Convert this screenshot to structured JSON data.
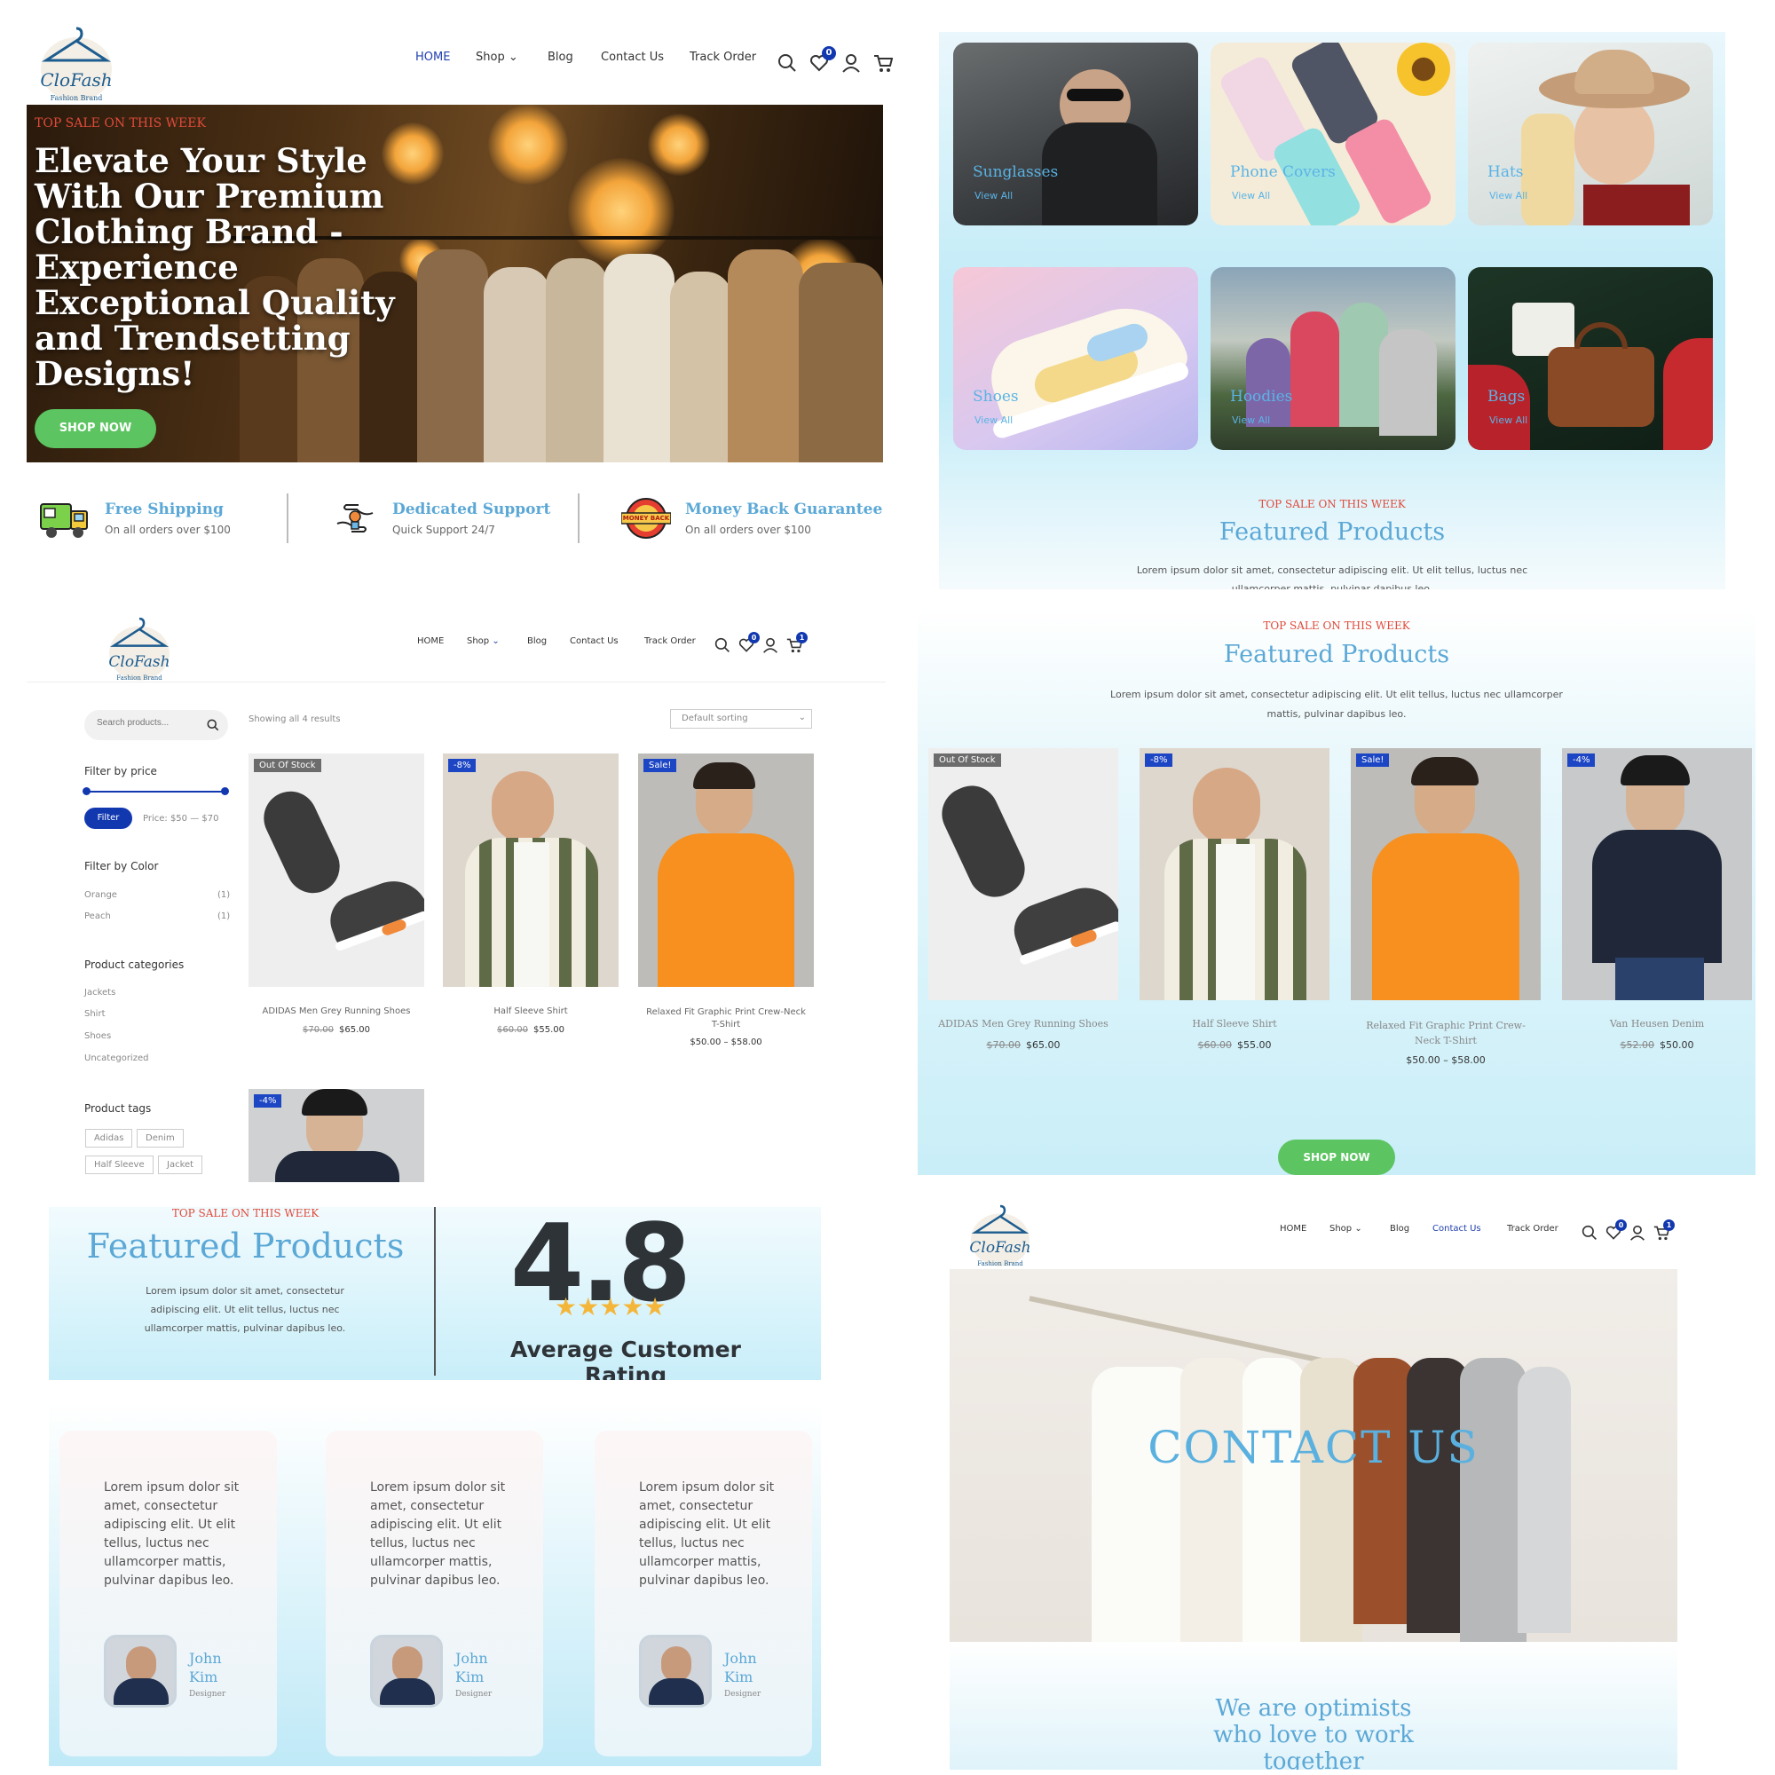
{
  "colors": {
    "accent_blue": "#5ba8d6",
    "nav_active": "#1f3fae",
    "sale_red": "#e04a3a",
    "button_green": "#5cc461",
    "badge_blue": "#1238b0",
    "panel_sky": "#bdeaf7"
  },
  "brand": {
    "logo_text": "CloFash",
    "logo_sub": "Fashion Brand"
  },
  "nav": {
    "home": "HOME",
    "shop": "Shop",
    "blog": "Blog",
    "contact": "Contact Us",
    "track": "Track Order",
    "wishlist_count": "0",
    "cart_count": "1"
  },
  "hero": {
    "eyebrow": "TOP SALE ON THIS WEEK",
    "title": "Elevate Your Style With Our Premium Clothing Brand - Experience Exceptional Quality and Trendsetting Designs!",
    "button": "SHOP NOW"
  },
  "features": [
    {
      "icon": "truck-icon",
      "title": "Free Shipping",
      "sub": "On all orders over $100"
    },
    {
      "icon": "support-icon",
      "title": "Dedicated Support",
      "sub": "Quick Support 24/7"
    },
    {
      "icon": "money-back-icon",
      "title": "Money Back Guarantee",
      "sub": "On all orders over $100",
      "badge_text": "MONEY BACK"
    }
  ],
  "categories": [
    {
      "name": "Sunglasses",
      "link": "View All"
    },
    {
      "name": "Phone Covers",
      "link": "View All"
    },
    {
      "name": "Hats",
      "link": "View All"
    },
    {
      "name": "Shoes",
      "link": "View All"
    },
    {
      "name": "Hoodies",
      "link": "View All"
    },
    {
      "name": "Bags",
      "link": "View All"
    }
  ],
  "featured": {
    "eyebrow": "TOP SALE ON THIS WEEK",
    "title": "Featured Products",
    "desc": "Lorem ipsum dolor sit amet, consectetur adipiscing elit. Ut elit tellus, luctus nec ullamcorper mattis, pulvinar dapibus leo."
  },
  "shop": {
    "search_placeholder": "Search products...",
    "result_count": "Showing all 4 results",
    "sorting": "Default sorting",
    "filter_price_heading": "Filter by price",
    "filter_button": "Filter",
    "price_range": "Price: $50 — $70",
    "filter_color_heading": "Filter by Color",
    "colors": [
      {
        "name": "Orange",
        "count": "(1)"
      },
      {
        "name": "Peach",
        "count": "(1)"
      }
    ],
    "categories_heading": "Product categories",
    "categories": [
      "Jackets",
      "Shirt",
      "Shoes",
      "Uncategorized"
    ],
    "tags_heading": "Product tags",
    "tags": [
      "Adidas",
      "Denim",
      "Half Sleeve",
      "Jacket"
    ]
  },
  "products": [
    {
      "name": "ADIDAS Men Grey Running Shoes",
      "old_price": "$70.00",
      "price": "$65.00",
      "tag": "Out Of Stock"
    },
    {
      "name": "Half Sleeve Shirt",
      "old_price": "$60.00",
      "price": "$55.00",
      "tag": "-8%"
    },
    {
      "name": "Relaxed Fit Graphic Print Crew-Neck T-Shirt",
      "old_price": "",
      "price": "$50.00 – $58.00",
      "tag": "Sale!"
    },
    {
      "name": "Van Heusen Denim",
      "old_price": "$52.00",
      "price": "$50.00",
      "tag": "-4%"
    }
  ],
  "featured_button": "SHOP NOW",
  "rating": {
    "value": "4.8",
    "label": "Average Customer Rating",
    "stars": 5
  },
  "testimonials": [
    {
      "text": "Lorem ipsum dolor sit amet, consectetur adipiscing elit. Ut elit tellus, luctus nec ullamcorper mattis, pulvinar dapibus leo.",
      "name": "John Kim",
      "role": "Designer"
    },
    {
      "text": "Lorem ipsum dolor sit amet, consectetur adipiscing elit. Ut elit tellus, luctus nec ullamcorper mattis, pulvinar dapibus leo.",
      "name": "John Kim",
      "role": "Designer"
    },
    {
      "text": "Lorem ipsum dolor sit amet, consectetur adipiscing elit. Ut elit tellus, luctus nec ullamcorper mattis, pulvinar dapibus leo.",
      "name": "John Kim",
      "role": "Designer"
    }
  ],
  "contact": {
    "hero_title": "CONTACT US",
    "tagline": "We are optimists who love to work together"
  }
}
